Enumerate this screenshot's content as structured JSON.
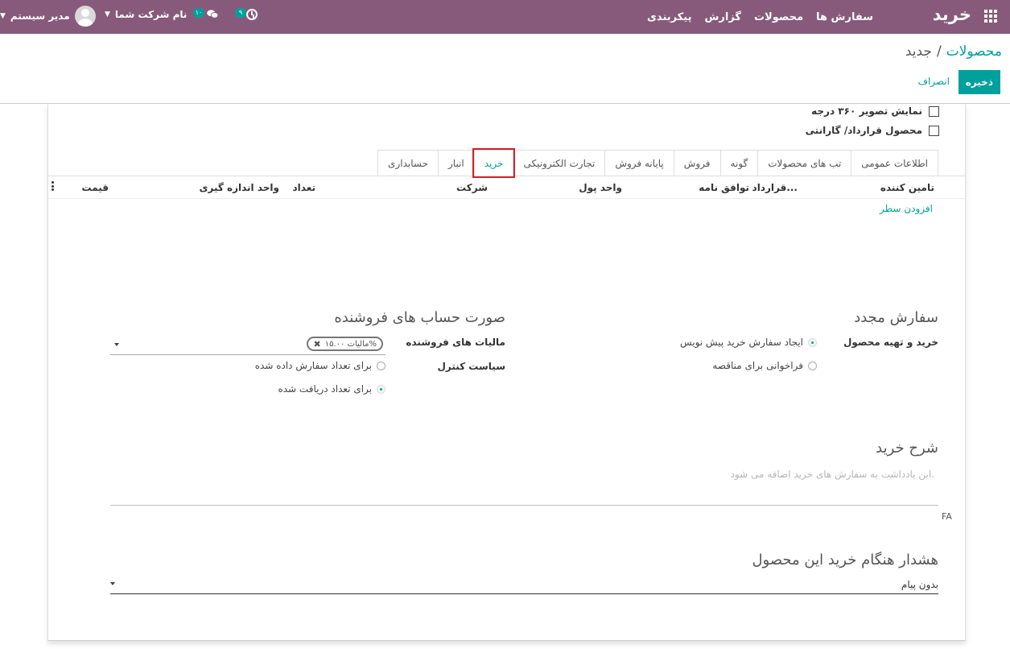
{
  "navbar": {
    "brand": "خرید",
    "menu": [
      "سفارش ها",
      "محصولات",
      "گزارش",
      "پیکربندی"
    ],
    "activity_badge": "۹",
    "messages_badge": "۱۰",
    "company": "نام شرکت شما",
    "user": "مدیر سیستم",
    "color": "#875a7b"
  },
  "breadcrumb": {
    "parent": "محصولات",
    "separator": "/",
    "current": "جدید"
  },
  "buttons": {
    "save": "ذخیره",
    "discard": "انصراف"
  },
  "checkboxes": {
    "view_360": "نمایش تصویر ۳۶۰ درجه",
    "warranty": "محصول قرارداد/ گارانتی"
  },
  "tabs": [
    "اطلاعات عمومی",
    "تب های محصولات",
    "گونه",
    "فروش",
    "پایانه فروش",
    "تجارت الکترونیکی",
    "خرید",
    "انبار",
    "حسابداری"
  ],
  "active_tab": "خرید",
  "vendor_table": {
    "columns": {
      "vendor": "تامین کننده",
      "contract": "قرارداد...",
      "agreement": "توافق نامه",
      "currency": "واحد پول",
      "company": "شرکت",
      "quantity": "تعداد",
      "uom": "واحد اندازه گیری",
      "price": "قیمت"
    },
    "add_line": "افزودن سطر"
  },
  "reorder": {
    "title": "سفارش مجدد",
    "label": "خرید و تهیه محصول",
    "options": [
      "ایجاد سفارش خرید پیش نویس",
      "فراخوانی برای مناقصه"
    ],
    "selected": 0
  },
  "vendor_bills": {
    "title": "صورت حساب های فروشنده",
    "taxes_label": "مالیات های فروشنده",
    "tax_tag": "مالیات ۱۵.۰۰%",
    "control_label": "سیاست کنترل",
    "control_options": [
      "برای تعداد سفارش داده شده",
      "برای تعداد دریافت شده"
    ],
    "control_selected": 1
  },
  "purchase_description": {
    "title": "شرح خرید",
    "placeholder": "این یادداشت به سفارش های خرید اضافه می شود.",
    "lang": "FA"
  },
  "warning": {
    "title": "هشدار هنگام خرید این محصول",
    "value": "بدون پیام"
  },
  "colors": {
    "accent": "#00a09d",
    "highlight": "#d0212b"
  }
}
